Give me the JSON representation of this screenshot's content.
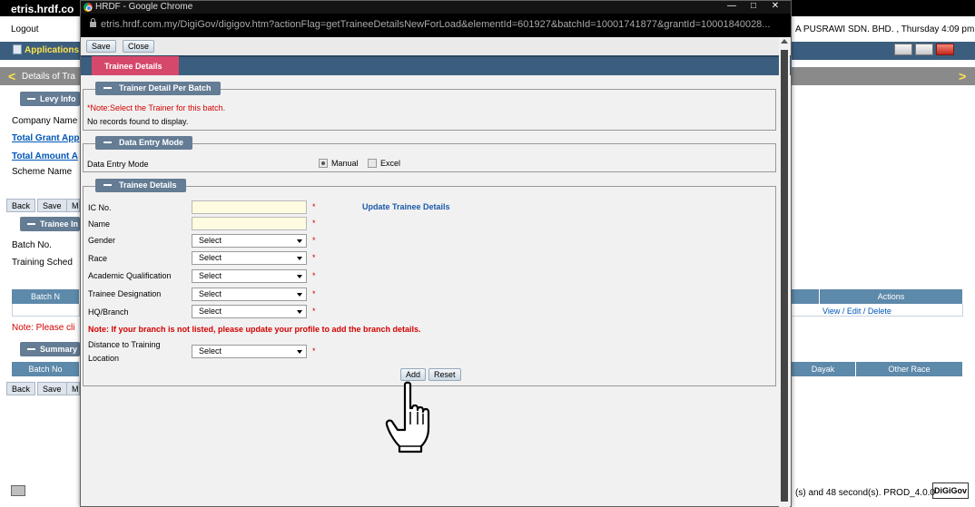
{
  "background": {
    "tab_title": "etris.hrdf.co",
    "logout": "Logout",
    "user_info": "A PUSRAWI SDN. BHD. , Thursday 4:09 pm",
    "app_label": "Applications",
    "nav_title": "Details of Tra",
    "nav_left": "<",
    "nav_right": ">",
    "levy_legend": "Levy Info",
    "company_name": "Company Name",
    "total_grant": "Total Grant App",
    "total_amount": "Total Amount A",
    "scheme_name": "Scheme Name",
    "btn_back": "Back",
    "btn_save": "Save",
    "btn_m": "M",
    "trainee_legend": "Trainee In",
    "batch_no": "Batch No.",
    "training_sched": "Training Sched",
    "batch_header": "Batch N",
    "actions_header": "Actions",
    "actions_links": "View / Edit / Delete",
    "note": "Note: Please cli",
    "summary_legend": "Summary",
    "summary_batch": "Batch No",
    "dayak": "Dayak",
    "other_race": "Other Race",
    "footer_time": "(s) and 48 second(s).",
    "footer_version": "PROD_4.0.0",
    "footer_logo": "DiGiGov"
  },
  "popup": {
    "title": "HRDF - Google Chrome",
    "url": "etris.hrdf.com.my/DigiGov/digigov.htm?actionFlag=getTraineeDetailsNewForLoad&elementId=601927&batchId=10001741877&grantId=10001840028...",
    "window_minimize": "—",
    "window_maximize": "□",
    "window_close": "✕",
    "toolbar": {
      "save": "Save",
      "close": "Close"
    },
    "active_tab": "Trainee Details",
    "trainer_section": {
      "legend": "Trainer Detail Per Batch",
      "note": "*Note:Select the Trainer for this batch.",
      "empty": "No records found to display."
    },
    "data_entry_section": {
      "legend": "Data Entry Mode",
      "label": "Data Entry Mode",
      "opt_manual": "Manual",
      "opt_excel": "Excel"
    },
    "trainee_section": {
      "legend": "Trainee Details",
      "ic_label": "IC No.",
      "name_label": "Name",
      "gender_label": "Gender",
      "race_label": "Race",
      "academic_label": "Academic Qualification",
      "designation_label": "Trainee Designation",
      "branch_label": "HQ/Branch",
      "distance_label_1": "Distance to Training",
      "distance_label_2": "Location",
      "select_text": "Select",
      "asterisk": "*",
      "update_link": "Update Trainee Details",
      "branch_note": "Note: If your branch is not listed, please update your profile to add the branch details.",
      "add_button": "Add",
      "reset_button": "Reset"
    }
  }
}
